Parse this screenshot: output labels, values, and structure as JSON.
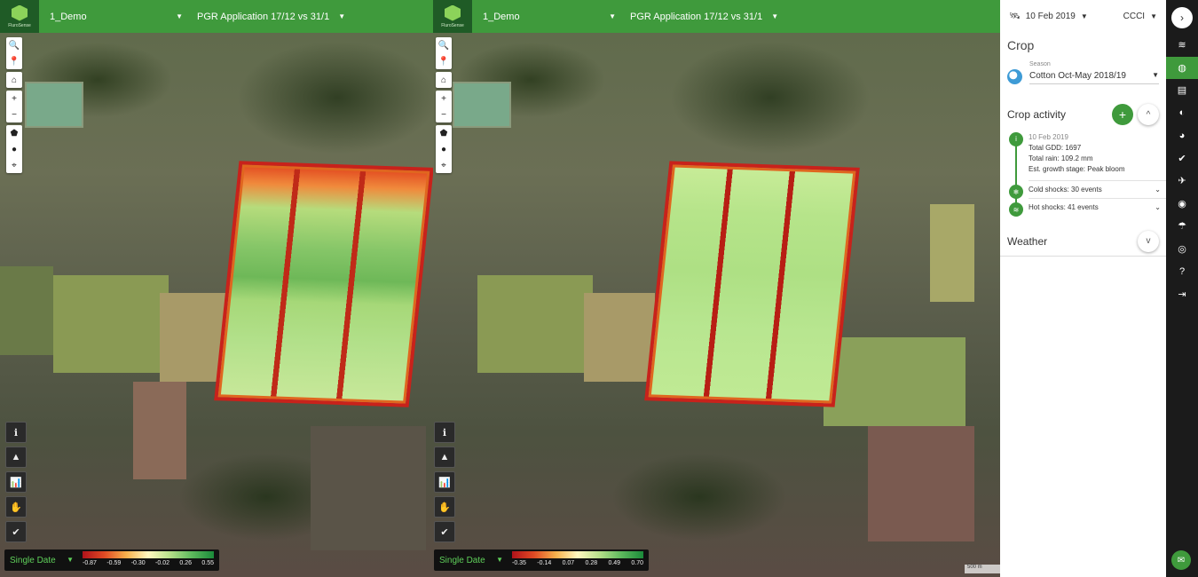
{
  "left_view": {
    "logo_text": "FluroSense",
    "project": "1_Demo",
    "compare": "PGR Application 17/12 vs 31/1",
    "legend_mode": "Single Date",
    "legend_ticks": [
      "-0.87",
      "-0.59",
      "-0.30",
      "-0.02",
      "0.26",
      "0.55"
    ]
  },
  "right_view": {
    "logo_text": "FluroSense",
    "project": "1_Demo",
    "compare": "PGR Application 17/12 vs 31/1",
    "legend_mode": "Single Date",
    "legend_ticks": [
      "-0.35",
      "-0.14",
      "0.07",
      "0.28",
      "0.49",
      "0.70"
    ]
  },
  "map_tools": {
    "search": "🔍",
    "pin": "📍",
    "home": "⌂",
    "zoom_in": "+",
    "zoom_out": "−",
    "draw_polygon": "⬟",
    "draw_circle": "●",
    "marker": "⌖"
  },
  "side_tools": [
    "ℹ",
    "▲",
    "📊",
    "✋",
    "✔"
  ],
  "scale_bar": "500 m",
  "panel": {
    "date": "10 Feb 2019",
    "index": "CCCI",
    "title": "Crop",
    "season_label": "Season",
    "season_value": "Cotton Oct-May 2018/19",
    "activity_title": "Crop activity",
    "add_label": "+",
    "collapse_label": "^",
    "entry": {
      "date": "10 Feb 2019",
      "gdd": "Total GDD: 1697",
      "rain": "Total rain: 109.2 mm",
      "stage": "Est. growth stage: Peak bloom"
    },
    "cold_shocks": "Cold shocks: 30 events",
    "hot_shocks": "Hot shocks: 41 events",
    "weather_title": "Weather",
    "expand_label": "v"
  },
  "rail": {
    "expand": "›",
    "icons": [
      "layers-icon",
      "globe-icon",
      "database-icon",
      "contrast-icon",
      "pie-icon",
      "check-circle-icon",
      "compass-icon",
      "sensor-icon",
      "umbrella-icon",
      "user-icon",
      "help-icon",
      "logout-icon"
    ],
    "glyphs": [
      "≋",
      "◍",
      "▤",
      "◐",
      "◕",
      "✔",
      "✈",
      "◉",
      "☂",
      "◎",
      "?",
      "⇥"
    ],
    "active_index": 1,
    "chat": "✉"
  },
  "colors": {
    "brand_green": "#3f9a3c",
    "dark_rail": "#1b1b1b"
  }
}
